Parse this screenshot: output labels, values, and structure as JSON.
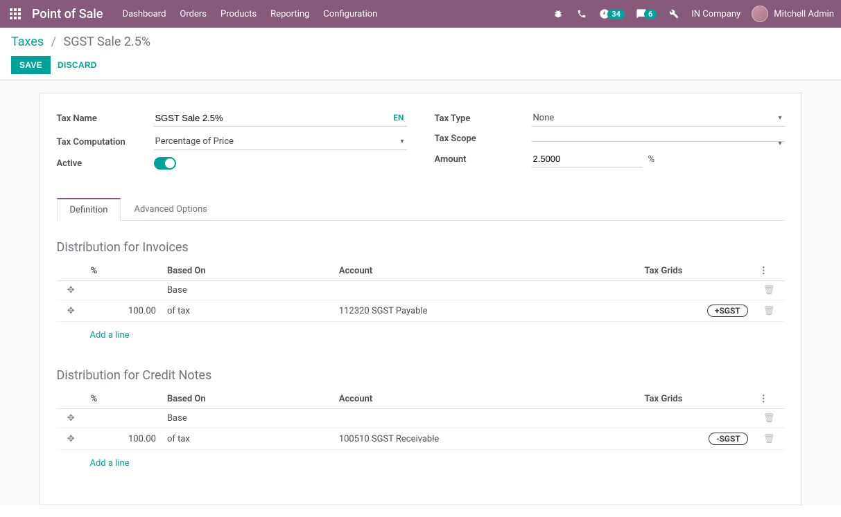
{
  "navbar": {
    "brand": "Point of Sale",
    "menu": [
      "Dashboard",
      "Orders",
      "Products",
      "Reporting",
      "Configuration"
    ],
    "activity_badge": "34",
    "discuss_badge": "6",
    "company": "IN Company",
    "user": "Mitchell Admin"
  },
  "breadcrumb": {
    "root": "Taxes",
    "current": "SGST Sale 2.5%"
  },
  "buttons": {
    "save": "SAVE",
    "discard": "DISCARD"
  },
  "form": {
    "tax_name_label": "Tax Name",
    "tax_name_value": "SGST Sale 2.5%",
    "lang": "EN",
    "tax_computation_label": "Tax Computation",
    "tax_computation_value": "Percentage of Price",
    "active_label": "Active",
    "tax_type_label": "Tax Type",
    "tax_type_value": "None",
    "tax_scope_label": "Tax Scope",
    "tax_scope_value": "",
    "amount_label": "Amount",
    "amount_value": "2.5000",
    "amount_suffix": "%"
  },
  "tabs": {
    "definition": "Definition",
    "advanced": "Advanced Options"
  },
  "sections": {
    "invoices_title": "Distribution for Invoices",
    "credit_notes_title": "Distribution for Credit Notes",
    "col_pct": "%",
    "col_based": "Based On",
    "col_account": "Account",
    "col_grids": "Tax Grids",
    "add_line": "Add a line"
  },
  "invoices_rows": [
    {
      "pct": "",
      "based": "Base",
      "account": "",
      "grid": ""
    },
    {
      "pct": "100.00",
      "based": "of tax",
      "account": "112320 SGST Payable",
      "grid": "+SGST"
    }
  ],
  "credit_rows": [
    {
      "pct": "",
      "based": "Base",
      "account": "",
      "grid": ""
    },
    {
      "pct": "100.00",
      "based": "of tax",
      "account": "100510 SGST Receivable",
      "grid": "-SGST"
    }
  ]
}
